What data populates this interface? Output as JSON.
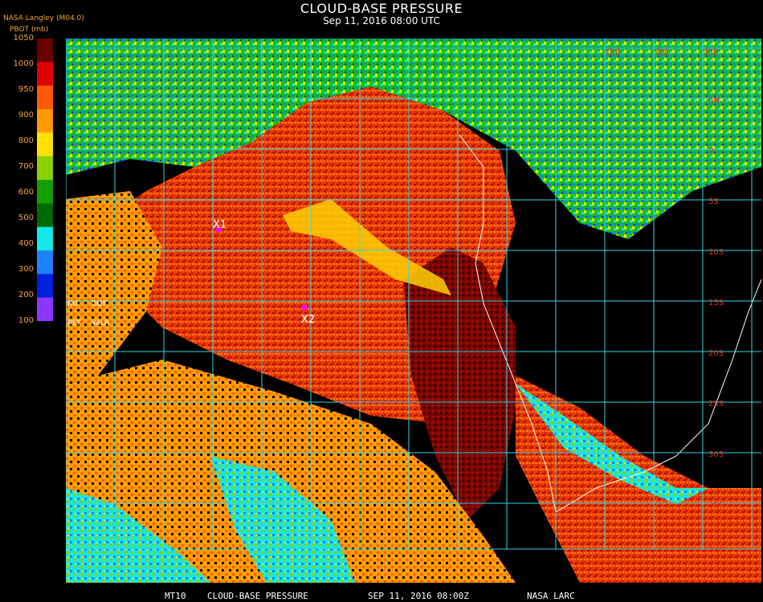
{
  "header": {
    "title": "CLOUD-BASE PRESSURE",
    "subtitle": "Sep 11, 2016 08:00 UTC",
    "org": "NASA Langley (M04.0)",
    "param": "PBOT (mb)"
  },
  "colorbar": {
    "labels": [
      "1050",
      "1000",
      "950",
      "900",
      "800",
      "700",
      "600",
      "500",
      "400",
      "300",
      "200",
      "100"
    ],
    "colors": [
      "#6a0000",
      "#e00000",
      "#ff5a00",
      "#ff9a00",
      "#ffe000",
      "#8cd000",
      "#12a000",
      "#006a00",
      "#14e8e8",
      "#1c82ff",
      "#0020e0",
      "#8a38ff"
    ]
  },
  "legend": {
    "no_data": "NO",
    "out": "OUT",
    "ret": "RET",
    "valr": "VALR"
  },
  "markers": [
    {
      "label": "X1",
      "color": "#ff00ff"
    },
    {
      "label": "X2",
      "color": "#ff00ff"
    }
  ],
  "grid_labels": [
    "25E",
    "30E",
    "35E",
    "5N",
    "0",
    "5S",
    "10S",
    "15S",
    "20S",
    "25S",
    "30S",
    "35S",
    "40S"
  ],
  "footer": {
    "product": "MT10",
    "name": "CLOUD-BASE PRESSURE",
    "date": "SEP 11, 2016 08:00Z",
    "source": "NASA LARC"
  }
}
